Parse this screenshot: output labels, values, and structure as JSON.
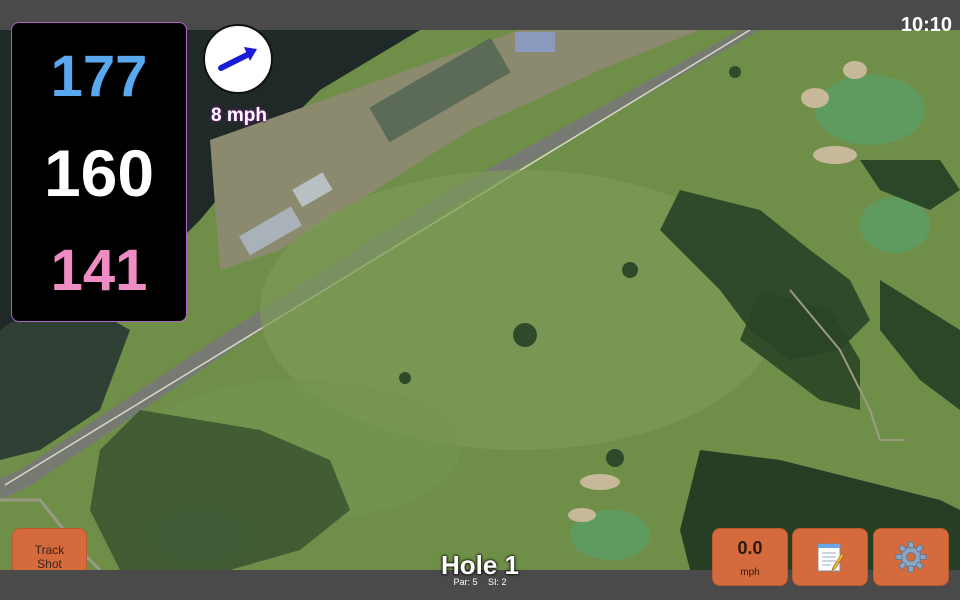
{
  "status_bar": {
    "time": "10:10"
  },
  "distances": {
    "back": "177",
    "center": "160",
    "front": "141"
  },
  "wind": {
    "speed": "8 mph",
    "icon": "wind-arrow-icon"
  },
  "controls": {
    "track_shot_line1": "Track",
    "track_shot_line2": "Shot",
    "speed_value": "0.0",
    "speed_unit": "mph",
    "notes_icon": "notepad-icon",
    "settings_icon": "gear-icon"
  },
  "hole": {
    "title": "Hole 1",
    "par": "Par: 5",
    "si": "SI: 2"
  },
  "colors": {
    "back": "#5aa8f0",
    "center": "#ffffff",
    "front": "#ef8cc3",
    "button": "#d56a3c",
    "bars": "#4a4a4a"
  }
}
